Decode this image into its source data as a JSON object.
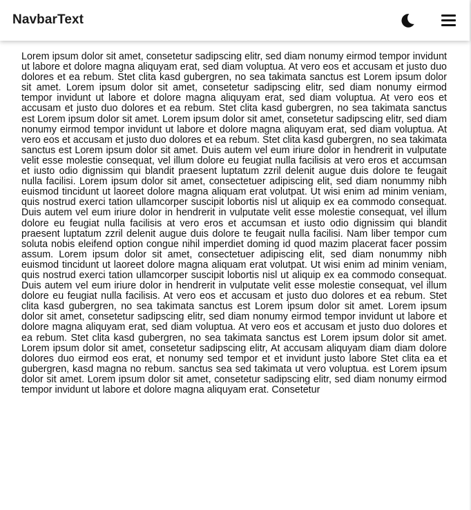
{
  "navbar": {
    "brand": "NavbarText",
    "theme_icon": "moon-icon",
    "menu_icon": "hamburger-menu-icon"
  },
  "content": {
    "paragraph": "Lorem ipsum dolor sit amet, consetetur sadipscing elitr, sed diam nonumy eirmod tempor invidunt ut labore et dolore magna aliquyam erat, sed diam voluptua. At vero eos et accusam et justo duo dolores et ea rebum. Stet clita kasd gubergren, no sea takimata sanctus est Lorem ipsum dolor sit amet. Lorem ipsum dolor sit amet, consetetur sadipscing elitr, sed diam nonumy eirmod tempor invidunt ut labore et dolore magna aliquyam erat, sed diam voluptua. At vero eos et accusam et justo duo dolores et ea rebum. Stet clita kasd gubergren, no sea takimata sanctus est Lorem ipsum dolor sit amet. Lorem ipsum dolor sit amet, consetetur sadipscing elitr, sed diam nonumy eirmod tempor invidunt ut labore et dolore magna aliquyam erat, sed diam voluptua. At vero eos et accusam et justo duo dolores et ea rebum. Stet clita kasd gubergren, no sea takimata sanctus est Lorem ipsum dolor sit amet. Duis autem vel eum iriure dolor in hendrerit in vulputate velit esse molestie consequat, vel illum dolore eu feugiat nulla facilisis at vero eros et accumsan et iusto odio dignissim qui blandit praesent luptatum zzril delenit augue duis dolore te feugait nulla facilisi. Lorem ipsum dolor sit amet, consectetuer adipiscing elit, sed diam nonummy nibh euismod tincidunt ut laoreet dolore magna aliquam erat volutpat. Ut wisi enim ad minim veniam, quis nostrud exerci tation ullamcorper suscipit lobortis nisl ut aliquip ex ea commodo consequat. Duis autem vel eum iriure dolor in hendrerit in vulputate velit esse molestie consequat, vel illum dolore eu feugiat nulla facilisis at vero eros et accumsan et iusto odio dignissim qui blandit praesent luptatum zzril delenit augue duis dolore te feugait nulla facilisi. Nam liber tempor cum soluta nobis eleifend option congue nihil imperdiet doming id quod mazim placerat facer possim assum. Lorem ipsum dolor sit amet, consectetuer adipiscing elit, sed diam nonummy nibh euismod tincidunt ut laoreet dolore magna aliquam erat volutpat. Ut wisi enim ad minim veniam, quis nostrud exerci tation ullamcorper suscipit lobortis nisl ut aliquip ex ea commodo consequat. Duis autem vel eum iriure dolor in hendrerit in vulputate velit esse molestie consequat, vel illum dolore eu feugiat nulla facilisis. At vero eos et accusam et justo duo dolores et ea rebum. Stet clita kasd gubergren, no sea takimata sanctus est Lorem ipsum dolor sit amet. Lorem ipsum dolor sit amet, consetetur sadipscing elitr, sed diam nonumy eirmod tempor invidunt ut labore et dolore magna aliquyam erat, sed diam voluptua. At vero eos et accusam et justo duo dolores et ea rebum. Stet clita kasd gubergren, no sea takimata sanctus est Lorem ipsum dolor sit amet. Lorem ipsum dolor sit amet, consetetur sadipscing elitr, At accusam aliquyam diam diam dolore dolores duo eirmod eos erat, et nonumy sed tempor et et invidunt justo labore Stet clita ea et gubergren, kasd magna no rebum. sanctus sea sed takimata ut vero voluptua. est Lorem ipsum dolor sit amet. Lorem ipsum dolor sit amet, consetetur sadipscing elitr, sed diam nonumy eirmod tempor invidunt ut labore et dolore magna aliquyam erat. Consetetur"
  }
}
